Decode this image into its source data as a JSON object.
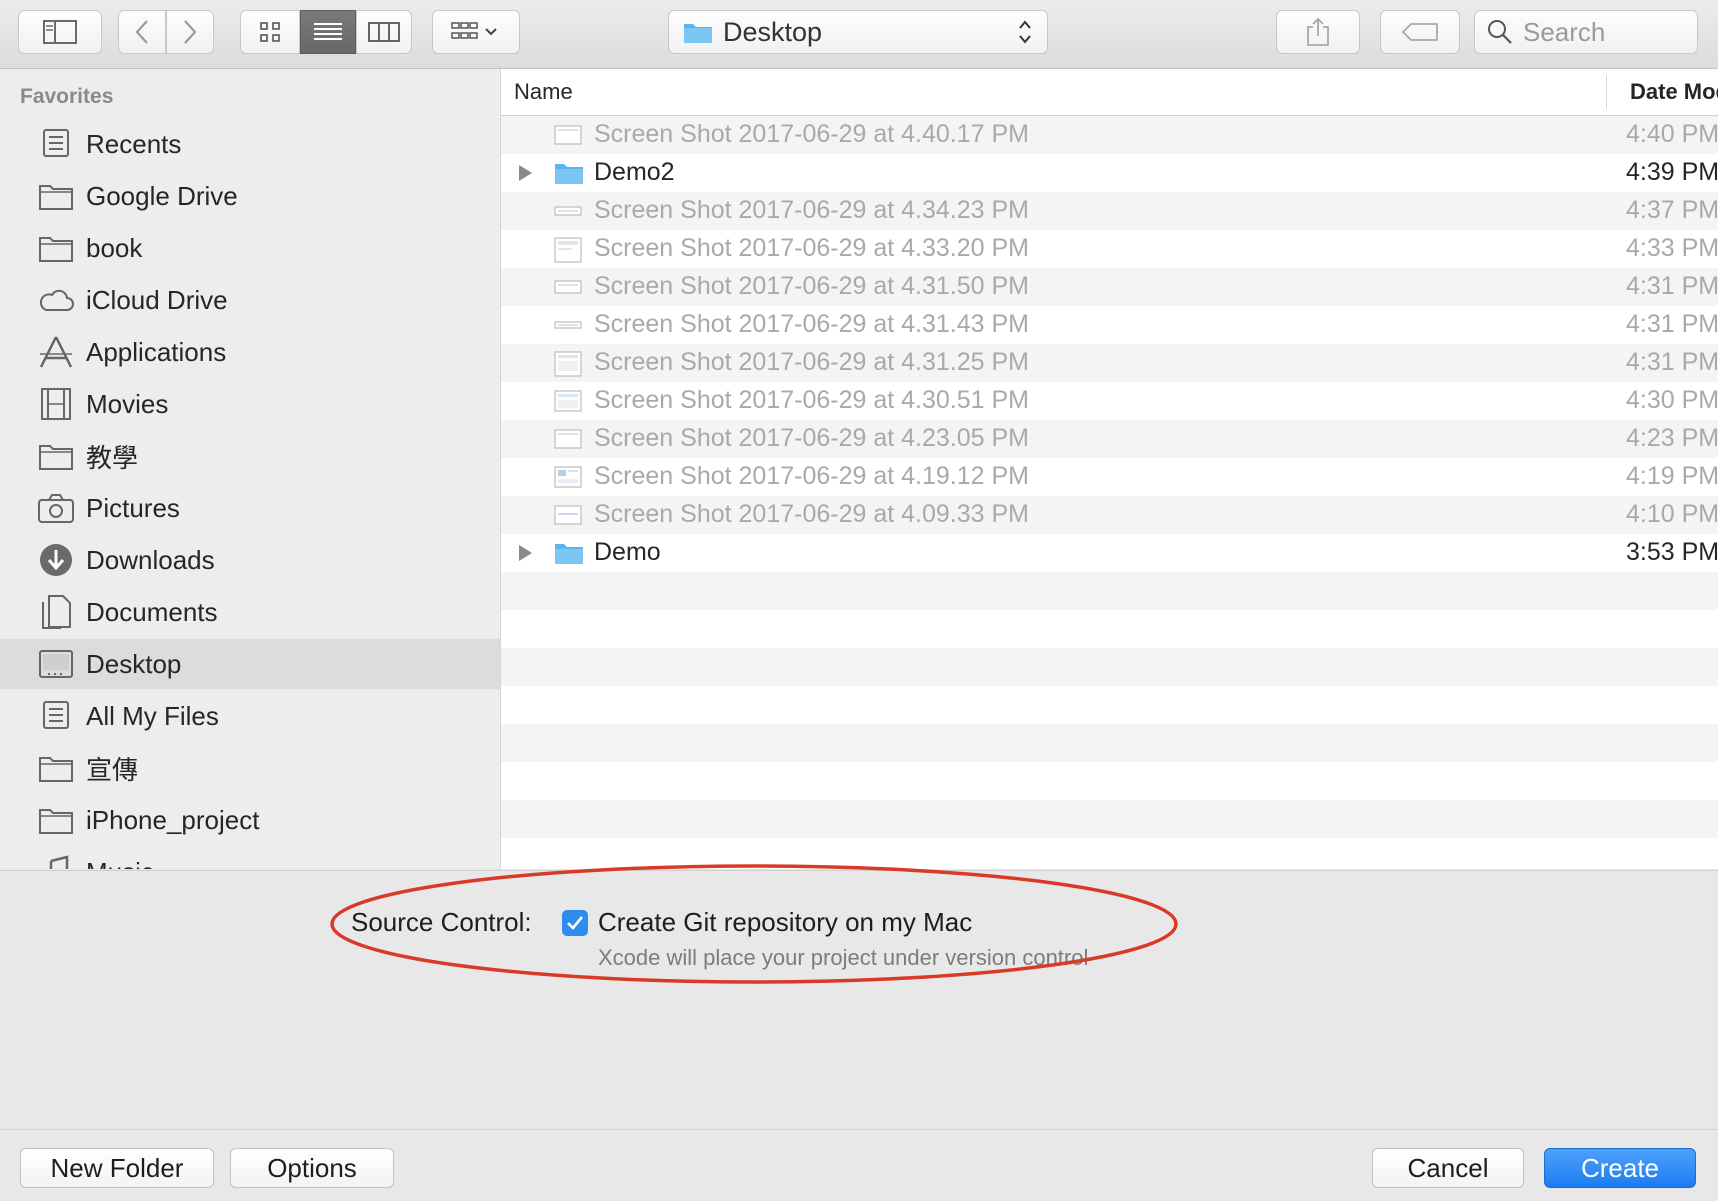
{
  "toolbar": {
    "location": "Desktop",
    "search_placeholder": "Search"
  },
  "sidebar": {
    "header": "Favorites",
    "items": [
      {
        "label": "Recents",
        "icon": "recents-icon"
      },
      {
        "label": "Google Drive",
        "icon": "folder-icon"
      },
      {
        "label": "book",
        "icon": "folder-icon"
      },
      {
        "label": "iCloud Drive",
        "icon": "cloud-icon"
      },
      {
        "label": "Applications",
        "icon": "applications-icon"
      },
      {
        "label": "Movies",
        "icon": "movies-icon"
      },
      {
        "label": "教學",
        "icon": "folder-icon"
      },
      {
        "label": "Pictures",
        "icon": "camera-icon"
      },
      {
        "label": "Downloads",
        "icon": "download-icon"
      },
      {
        "label": "Documents",
        "icon": "documents-icon"
      },
      {
        "label": "Desktop",
        "icon": "desktop-icon",
        "selected": true
      },
      {
        "label": "All My Files",
        "icon": "all-files-icon"
      },
      {
        "label": "宣傳",
        "icon": "folder-icon"
      },
      {
        "label": "iPhone_project",
        "icon": "folder-icon"
      },
      {
        "label": "Music",
        "icon": "music-icon"
      }
    ]
  },
  "file_list": {
    "columns": {
      "name": "Name",
      "date": "Date Modified"
    },
    "rows": [
      {
        "name": "Screen Shot 2017-06-29 at 4.40.17 PM",
        "date": "4:40 PM",
        "type": "image"
      },
      {
        "name": "Demo2",
        "date": "4:39 PM",
        "type": "folder"
      },
      {
        "name": "Screen Shot 2017-06-29 at 4.34.23 PM",
        "date": "4:37 PM",
        "type": "image"
      },
      {
        "name": "Screen Shot 2017-06-29 at 4.33.20 PM",
        "date": "4:33 PM",
        "type": "image"
      },
      {
        "name": "Screen Shot 2017-06-29 at 4.31.50 PM",
        "date": "4:31 PM",
        "type": "image"
      },
      {
        "name": "Screen Shot 2017-06-29 at 4.31.43 PM",
        "date": "4:31 PM",
        "type": "image"
      },
      {
        "name": "Screen Shot 2017-06-29 at 4.31.25 PM",
        "date": "4:31 PM",
        "type": "image"
      },
      {
        "name": "Screen Shot 2017-06-29 at 4.30.51 PM",
        "date": "4:30 PM",
        "type": "image"
      },
      {
        "name": "Screen Shot 2017-06-29 at 4.23.05 PM",
        "date": "4:23 PM",
        "type": "image"
      },
      {
        "name": "Screen Shot 2017-06-29 at 4.19.12 PM",
        "date": "4:19 PM",
        "type": "image"
      },
      {
        "name": "Screen Shot 2017-06-29 at 4.09.33 PM",
        "date": "4:10 PM",
        "type": "image"
      },
      {
        "name": "Demo",
        "date": "3:53 PM",
        "type": "folder"
      }
    ]
  },
  "options": {
    "source_control_label": "Source Control:",
    "checkbox_label": "Create Git repository on my Mac",
    "checkbox_checked": true,
    "checkbox_description": "Xcode will place your project under version control"
  },
  "buttons": {
    "new_folder": "New Folder",
    "options": "Options",
    "cancel": "Cancel",
    "create": "Create"
  },
  "colors": {
    "accent": "#2d8cf0",
    "annotation": "#d93a28",
    "folder": "#5ab4ee"
  }
}
